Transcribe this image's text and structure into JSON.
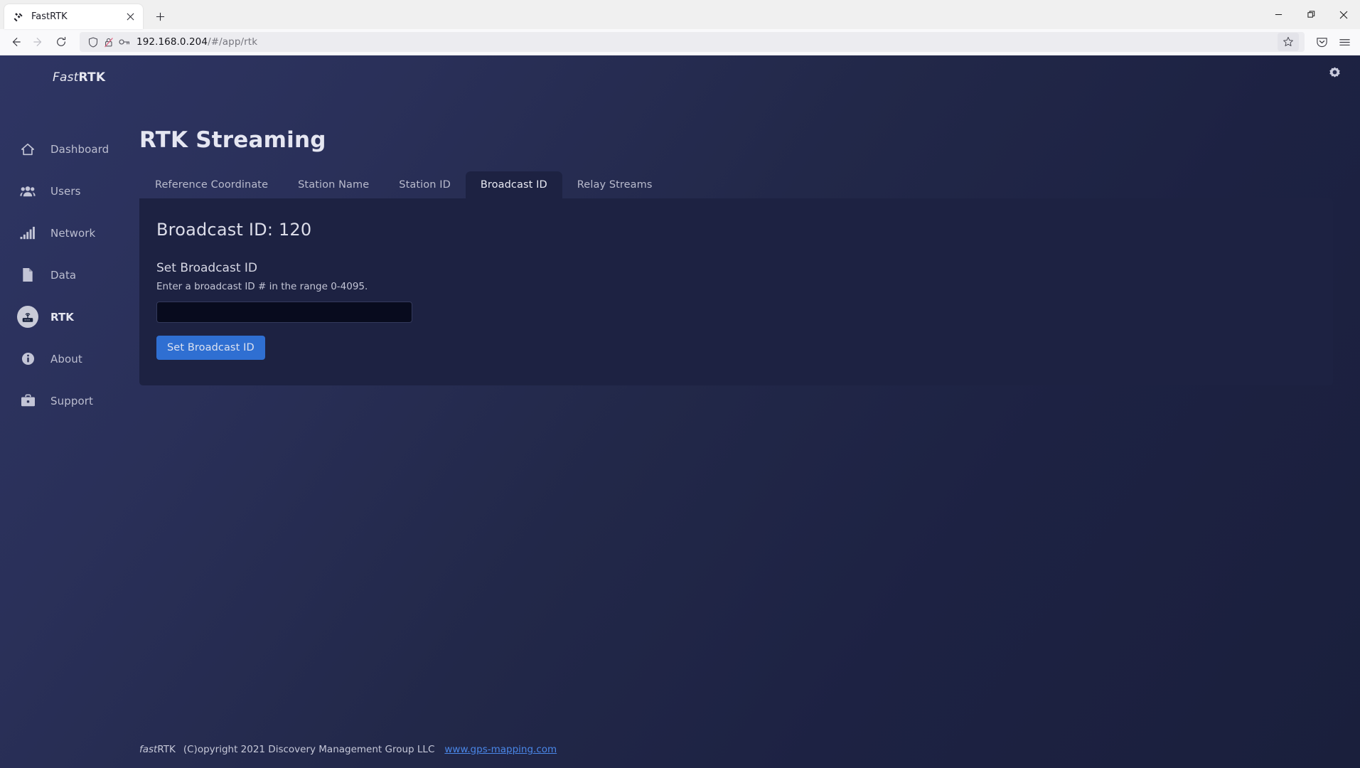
{
  "browser": {
    "tab": {
      "title": "FastRTK",
      "favicon_icon": "satellite-icon",
      "close_icon": "close-icon"
    },
    "new_tab_label": "+",
    "window_controls": {
      "minimize": "minimize-icon",
      "maximize": "maximize-icon",
      "close": "close-icon"
    },
    "nav": {
      "back_icon": "back-arrow-icon",
      "forward_icon": "forward-arrow-icon",
      "reload_icon": "reload-icon"
    },
    "url": {
      "shield_icon": "shield-icon",
      "lock_broken_icon": "lock-crossed-icon",
      "key_icon": "key-icon",
      "host": "192.168.0.204",
      "path": "/#/app/rtk",
      "bookmark_icon": "star-icon"
    },
    "toolbar_right": {
      "pocket_icon": "pocket-save-icon",
      "menu_icon": "hamburger-menu-icon"
    }
  },
  "app": {
    "brand": {
      "part1": "Fast",
      "part2": "RTK"
    },
    "settings_icon": "gear-icon",
    "sidebar": {
      "items": [
        {
          "label": "Dashboard",
          "icon": "home-icon",
          "active": false
        },
        {
          "label": "Users",
          "icon": "users-icon",
          "active": false
        },
        {
          "label": "Network",
          "icon": "signal-bars-icon",
          "active": false
        },
        {
          "label": "Data",
          "icon": "document-icon",
          "active": false
        },
        {
          "label": "RTK",
          "icon": "router-icon",
          "active": true
        },
        {
          "label": "About",
          "icon": "info-circle-icon",
          "active": false
        },
        {
          "label": "Support",
          "icon": "briefcase-icon",
          "active": false
        }
      ]
    },
    "main": {
      "page_title": "RTK Streaming",
      "tabs": [
        {
          "label": "Reference Coordinate",
          "active": false
        },
        {
          "label": "Station Name",
          "active": false
        },
        {
          "label": "Station ID",
          "active": false
        },
        {
          "label": "Broadcast ID",
          "active": true
        },
        {
          "label": "Relay Streams",
          "active": false
        }
      ],
      "card": {
        "title": "Broadcast ID: 120",
        "current_value": "120",
        "field_label": "Set Broadcast ID",
        "field_help": "Enter a broadcast ID # in the range 0-4095.",
        "input_value": "",
        "input_placeholder": "",
        "submit_label": "Set Broadcast ID"
      }
    },
    "footer": {
      "brand_italic": "fast",
      "brand_bold": "RTK",
      "copyright": "(C)opyright 2021 Discovery Management Group LLC",
      "link": "www.gps-mapping.com"
    },
    "colors": {
      "accent_blue": "#2f6fd2",
      "link_blue": "#4a87e8",
      "card_bg": "#1d2242",
      "sidebar_text": "#bcbed0"
    }
  }
}
